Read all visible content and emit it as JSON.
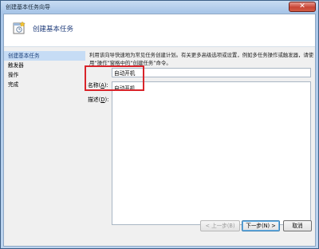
{
  "window": {
    "title": "创建基本任务向导",
    "close_glyph": "✕"
  },
  "header": {
    "title": "创建基本任务",
    "icon": "task-wizard-icon"
  },
  "nav": {
    "items": [
      {
        "label": "创建基本任务",
        "selected": true
      },
      {
        "label": "触发器",
        "selected": false
      },
      {
        "label": "操作",
        "selected": false
      },
      {
        "label": "完成",
        "selected": false
      }
    ]
  },
  "main": {
    "description": "利用该向导快速地为常见任务创建计划。有关更多高级选项或设置，例如多任务操作或触发器，请使用“操作”窗格中的“创建任务”命令。",
    "name_label": "名称(",
    "name_key": "A",
    "name_suffix": "):",
    "name_value": "自动开机",
    "desc_label": "描述(",
    "desc_key": "D",
    "desc_suffix": "):",
    "desc_value": "自动开机"
  },
  "buttons": {
    "back": "< 上一步(B)",
    "next": "下一步(N) >",
    "cancel": "取消"
  },
  "colors": {
    "highlight": "#d9242a",
    "selected_nav": "#c6dcf5",
    "header_title": "#1e3b7a"
  }
}
